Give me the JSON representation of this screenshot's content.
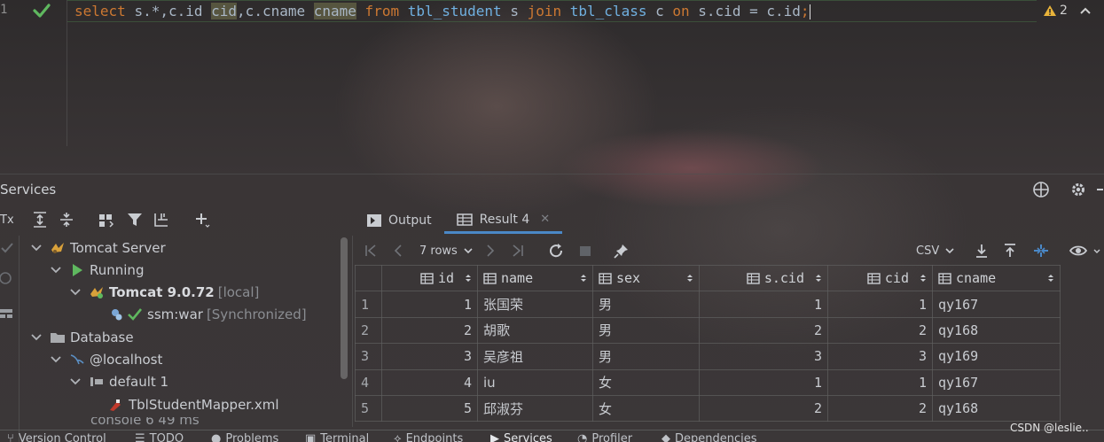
{
  "editor": {
    "line_number": "1",
    "sql_parts": [
      {
        "t": "select ",
        "c": "kw"
      },
      {
        "t": "s.*,c.id ",
        "c": "ident"
      },
      {
        "t": "cid",
        "c": "hl"
      },
      {
        "t": ",c.cname ",
        "c": "ident"
      },
      {
        "t": "cname",
        "c": "hl"
      },
      {
        "t": " from ",
        "c": "kw"
      },
      {
        "t": "tbl_student",
        "c": "tbl"
      },
      {
        "t": " s ",
        "c": "ident"
      },
      {
        "t": "join ",
        "c": "kw"
      },
      {
        "t": "tbl_class",
        "c": "tbl"
      },
      {
        "t": " c ",
        "c": "ident"
      },
      {
        "t": "on ",
        "c": "kw"
      },
      {
        "t": "s.cid = c.id",
        "c": "ident"
      },
      {
        "t": ";",
        "c": "kw"
      }
    ],
    "warning_count": "2"
  },
  "services": {
    "title": "Services"
  },
  "left_toolbar": {
    "tx_label": "Tx"
  },
  "tree": {
    "tomcat_server": "Tomcat Server",
    "running": "Running",
    "tomcat_instance": "Tomcat 9.0.72",
    "tomcat_instance_suffix": "[local]",
    "artifact": "ssm:war",
    "artifact_status": "[Synchronized]",
    "database": "Database",
    "localhost": "@localhost",
    "default_schema": "default 1",
    "mapper_file": "TblStudentMapper.xml",
    "console_partial": "console 6 49 ms"
  },
  "result_tabs": {
    "output": "Output",
    "result": "Result 4"
  },
  "grid_toolbar": {
    "rows_label": "7 rows",
    "export_format": "CSV"
  },
  "table": {
    "columns": [
      "id",
      "name",
      "sex",
      "s.cid",
      "cid",
      "cname"
    ],
    "rows": [
      {
        "n": "1",
        "id": "1",
        "name": "张国荣",
        "sex": "男",
        "scid": "1",
        "cid": "1",
        "cname": "qy167"
      },
      {
        "n": "2",
        "id": "2",
        "name": "胡歌",
        "sex": "男",
        "scid": "2",
        "cid": "2",
        "cname": "qy168"
      },
      {
        "n": "3",
        "id": "3",
        "name": "吴彦祖",
        "sex": "男",
        "scid": "3",
        "cid": "3",
        "cname": "qy169"
      },
      {
        "n": "4",
        "id": "4",
        "name": "iu",
        "sex": "女",
        "scid": "1",
        "cid": "1",
        "cname": "qy167"
      },
      {
        "n": "5",
        "id": "5",
        "name": "邱淑芬",
        "sex": "女",
        "scid": "2",
        "cid": "2",
        "cname": "qy168"
      }
    ]
  },
  "bottom_bar": {
    "version_control": "Version Control",
    "todo": "TODO",
    "problems": "Problems",
    "terminal": "Terminal",
    "endpoints": "Endpoints",
    "services": "Services",
    "profiler": "Profiler",
    "dependencies": "Dependencies"
  },
  "watermark": "CSDN @leslie..",
  "colors": {
    "keyword": "#cc7832",
    "table_name": "#70b0e0",
    "accent": "#4a88c7",
    "success": "#5fb85f",
    "warning": "#e8b33a"
  }
}
